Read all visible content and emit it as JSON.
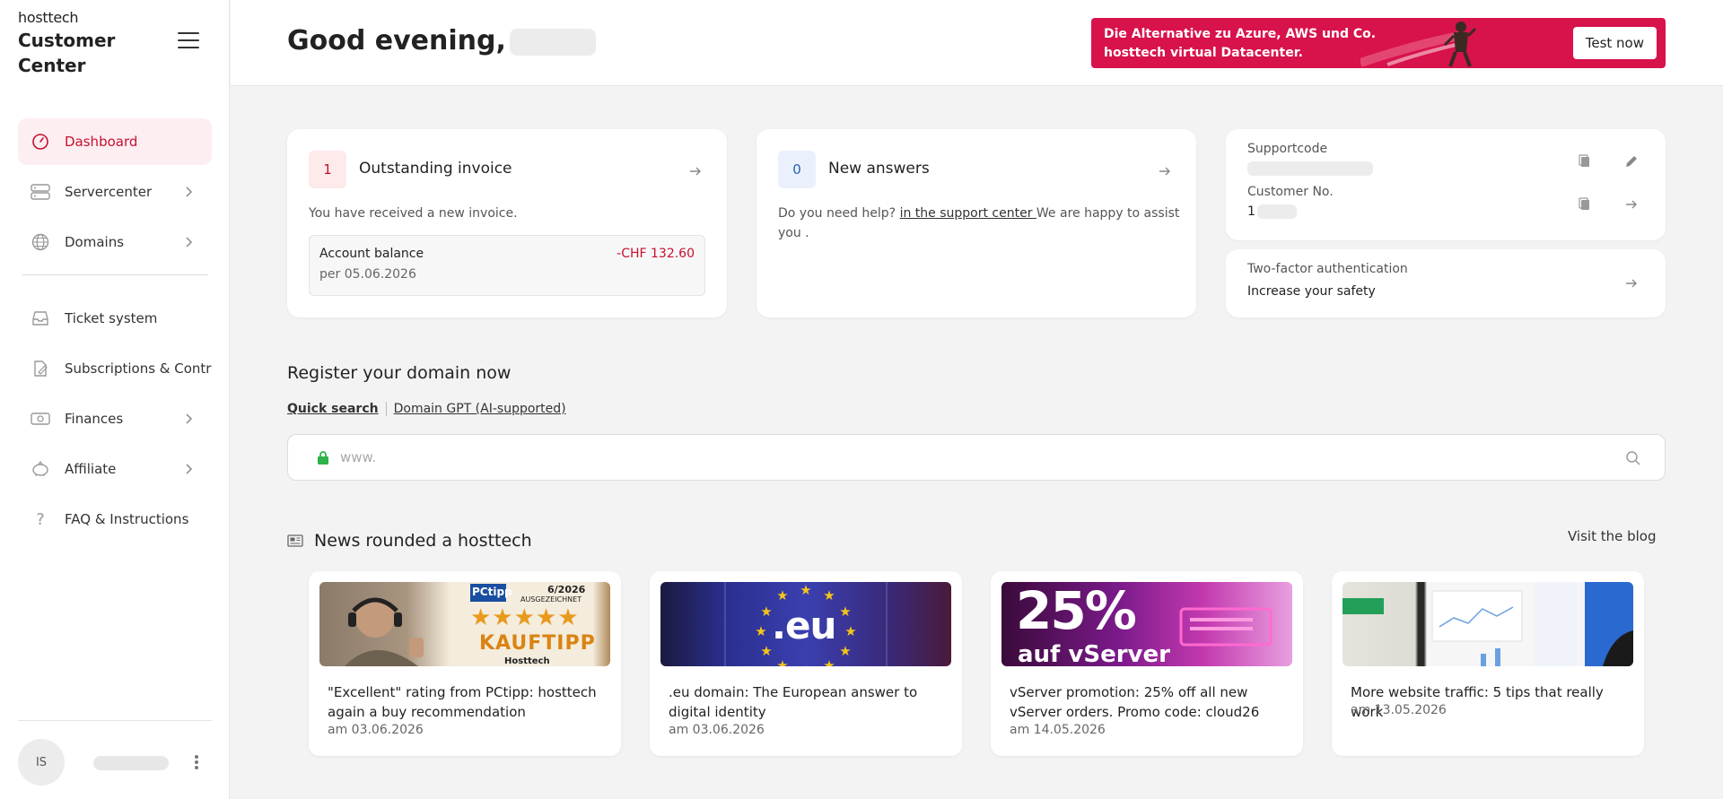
{
  "sidebar": {
    "brand_logo": "hosttech",
    "brand_title_line1": "Customer",
    "brand_title_line2": "Center",
    "items": [
      {
        "label": "Dashboard"
      },
      {
        "label": "Servercenter"
      },
      {
        "label": "Domains"
      },
      {
        "label": "Ticket system"
      },
      {
        "label": "Subscriptions & Contracts"
      },
      {
        "label": "Finances"
      },
      {
        "label": "Affiliate"
      },
      {
        "label": "FAQ & Instructions"
      }
    ],
    "avatar_initials": "IS"
  },
  "header": {
    "greeting": "Good evening,",
    "promo_line1": "Die Alternative zu Azure, AWS und Co.",
    "promo_line2": "hosttech virtual Datacenter.",
    "promo_button": "Test now"
  },
  "invoice_card": {
    "count": "1",
    "title": "Outstanding invoice",
    "text": "You have received a new invoice.",
    "balance_label": "Account balance",
    "balance_date": "per 05.06.2026",
    "balance_amount": "-CHF 132.60"
  },
  "answers_card": {
    "count": "0",
    "title": "New answers",
    "text_before": "Do you need help? ",
    "link": "in the support center ",
    "text_after": "We are happy to assist you ."
  },
  "account_card": {
    "supportcode_label": "Supportcode",
    "customer_label": "Customer No.",
    "customer_prefix": "1"
  },
  "twofa_card": {
    "label": "Two-factor authentication",
    "value": "Increase your safety"
  },
  "domain": {
    "title": "Register your domain now",
    "tab_quick": "Quick search",
    "tab_gpt": "Domain GPT (AI-supported)",
    "placeholder": "www."
  },
  "news": {
    "title": "News rounded a hosttech",
    "visit_blog": "Visit the blog",
    "items": [
      {
        "title": "\"Excellent\" rating from PCtipp: hosttech again a buy recommendation",
        "date": "am 03.06.2026",
        "img_badge": "PCtipp",
        "img_edition": "6/2026",
        "img_award": "AUSGEZEICHNET",
        "img_text": "KAUFTIPP",
        "img_sub": "Hosttech"
      },
      {
        "title": ".eu domain: The European answer to digital identity",
        "date": "am 03.06.2026",
        "img_text": ".eu"
      },
      {
        "title": "vServer promotion: 25% off all new vServer orders. Promo code: cloud26",
        "date": "am 14.05.2026",
        "img_text": "25%",
        "img_sub": "auf vServer"
      },
      {
        "title": "More website traffic: 5 tips that really work",
        "date": "am 13.05.2026"
      }
    ]
  },
  "colors": {
    "accent": "#c8102e",
    "promo": "#d8124b",
    "active_bg": "#fdeef2"
  }
}
